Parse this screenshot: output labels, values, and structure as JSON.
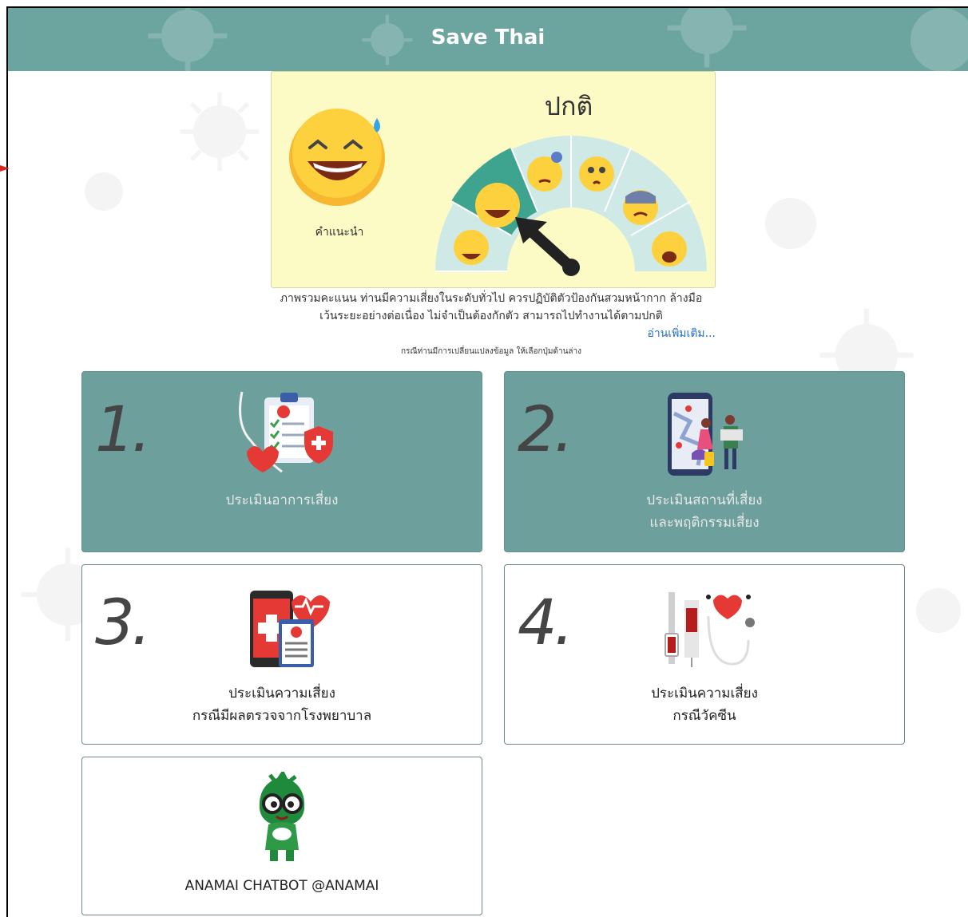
{
  "app": {
    "title": "Save Thai"
  },
  "result": {
    "level": "ปกติ",
    "advice_label": "คำแนะนำ",
    "summary_line1": "ภาพรวมคะแนน ท่านมีความเสี่ยงในระดับทั่วไป ควรปฏิบัติตัวป้องกันสวมหน้ากาก ล้างมือ",
    "summary_line2": "เว้นระยะอย่างต่อเนื่อง ไม่จำเป็นต้องกักตัว สามารถไปทำงานได้ตามปกติ",
    "read_more": "อ่านเพิ่มเติม...",
    "note": "กรณีท่านมีการเปลี่ยนแปลงข้อมูล ให้เลือกปุ่มด้านล่าง"
  },
  "tiles": [
    {
      "number": "1.",
      "line1": "ประเมินอาการเสี่ยง",
      "line2": ""
    },
    {
      "number": "2.",
      "line1": "ประเมินสถานที่เสี่ยง",
      "line2": "และพฤติกรรมเสี่ยง"
    },
    {
      "number": "3.",
      "line1": "ประเมินความเสี่ยง",
      "line2": "กรณีมีผลตรวจจากโรงพยาบาล"
    },
    {
      "number": "4.",
      "line1": "ประเมินความเสี่ยง",
      "line2": "กรณีวัคซีน"
    },
    {
      "number": "",
      "line1": "ANAMAI CHATBOT @ANAMAI",
      "line2": ""
    }
  ],
  "colors": {
    "header": "#6ca4a0",
    "result_card": "#fdfbc5",
    "tile_teal": "#6da09c",
    "link": "#1e6fc4"
  },
  "icons": {
    "tile1": "medical-checklist-icon",
    "tile2": "map-phone-travelers-icon",
    "tile3": "mobile-health-report-icon",
    "tile4": "vaccine-syringe-stethoscope-icon",
    "tile5": "anamai-mascot-icon"
  }
}
